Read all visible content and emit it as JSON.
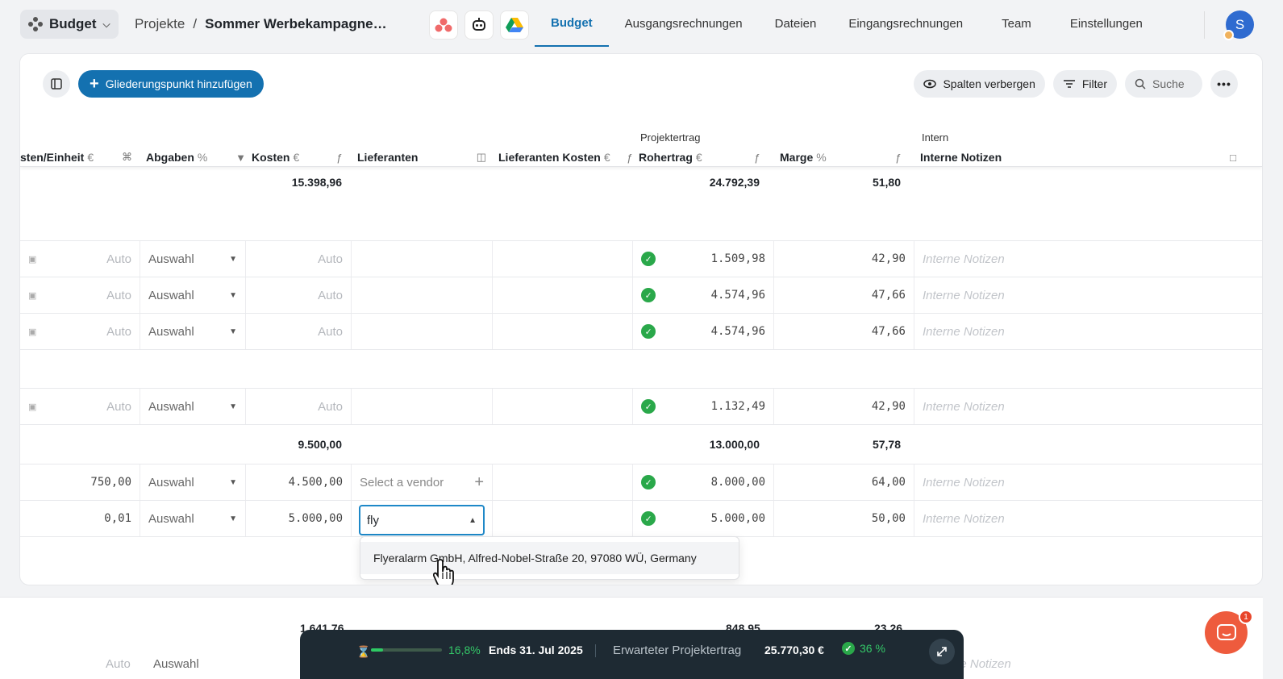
{
  "app": {
    "name": "Budget"
  },
  "breadcrumb": {
    "parent": "Projekte",
    "separator": "/",
    "current": "Sommer Werbekampagne…"
  },
  "nav_tabs": [
    "Budget",
    "Ausgangsrechnungen",
    "Dateien",
    "Eingangsrechnungen",
    "Team",
    "Einstellungen"
  ],
  "avatar": {
    "initial": "S"
  },
  "toolbar": {
    "add_label": "Gliederungspunkt hinzufügen",
    "hide_columns": "Spalten verbergen",
    "filter": "Filter",
    "search": "Suche"
  },
  "groups": {
    "projektertrag": "Projektertrag",
    "intern": "Intern"
  },
  "columns": {
    "kosten_einheit": "sten/Einheit",
    "abgaben": "Abgaben",
    "kosten": "Kosten",
    "lieferanten": "Lieferanten",
    "lieferanten_kosten": "Lieferanten Kosten",
    "rohertrag": "Rohertrag",
    "marge": "Marge",
    "notizen": "Interne Notizen",
    "unit_eur": "€",
    "unit_pct": "%"
  },
  "rows": {
    "sum1": {
      "kosten": "15.398,96",
      "rohertrag": "24.792,39",
      "marge": "51,80"
    },
    "r1": {
      "einheit": "Auto",
      "abgaben": "Auswahl",
      "kosten": "Auto",
      "rohertrag": "1.509,98",
      "marge": "42,90",
      "notizen": "Interne Notizen"
    },
    "r2": {
      "einheit": "Auto",
      "abgaben": "Auswahl",
      "kosten": "Auto",
      "rohertrag": "4.574,96",
      "marge": "47,66",
      "notizen": "Interne Notizen"
    },
    "r3": {
      "einheit": "Auto",
      "abgaben": "Auswahl",
      "kosten": "Auto",
      "rohertrag": "4.574,96",
      "marge": "47,66",
      "notizen": "Interne Notizen"
    },
    "r4": {
      "einheit": "Auto",
      "abgaben": "Auswahl",
      "kosten": "Auto",
      "rohertrag": "1.132,49",
      "marge": "42,90",
      "notizen": "Interne Notizen"
    },
    "sum2": {
      "kosten": "9.500,00",
      "rohertrag": "13.000,00",
      "marge": "57,78"
    },
    "r5": {
      "einheit": "750,00",
      "abgaben": "Auswahl",
      "kosten": "4.500,00",
      "vendor_placeholder": "Select a vendor",
      "rohertrag": "8.000,00",
      "marge": "64,00",
      "notizen": "Interne Notizen"
    },
    "r6": {
      "einheit": "0,01",
      "abgaben": "Auswahl",
      "kosten": "5.000,00",
      "vendor_input": "fly",
      "rohertrag": "5.000,00",
      "marge": "50,00",
      "notizen": "Interne Notizen"
    }
  },
  "dropdown": {
    "option": "Flyeralarm GmbH, Alfred-Nobel-Straße 20, 97080 WÜ, Germany"
  },
  "section2": {
    "kosten": "1.641,76",
    "rohertrag": "848,95",
    "marge": "23,26",
    "einheit": "Auto",
    "abgaben": "Auswahl",
    "notizen": "Interne Notizen"
  },
  "statusbar": {
    "progress_pct": 16.8,
    "progress_label": "16,8%",
    "ends": "Ends 31. Jul 2025",
    "expected_label": "Erwarteter Projektertrag",
    "expected_value": "25.770,30 €",
    "expected_pct": "36 %"
  },
  "chat": {
    "badge": "1"
  },
  "colors": {
    "accent": "#1471b0",
    "success": "#2aa84a",
    "status_bg": "#1e2a33",
    "chat": "#ee5b3d"
  }
}
